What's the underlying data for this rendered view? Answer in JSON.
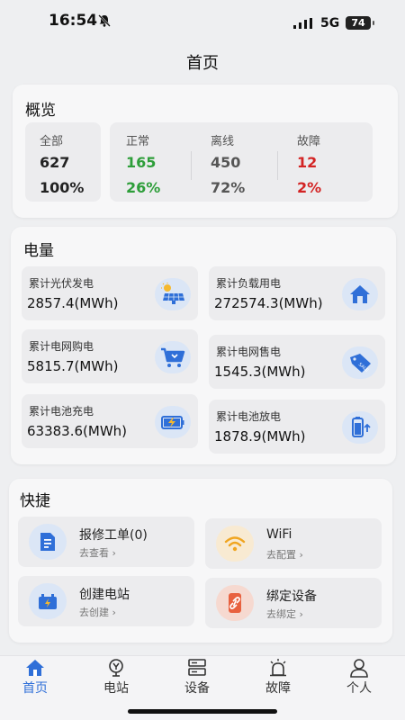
{
  "status_bar": {
    "time": "16:54",
    "network": "5G",
    "battery": "74"
  },
  "page": {
    "title": "首页"
  },
  "overview": {
    "title": "概览",
    "all": {
      "label": "全部",
      "count": "627",
      "percent": "100%"
    },
    "normal": {
      "label": "正常",
      "count": "165",
      "percent": "26%",
      "color": "#2e9e3a"
    },
    "offline": {
      "label": "离线",
      "count": "450",
      "percent": "72%",
      "color": "#555555"
    },
    "fault": {
      "label": "故障",
      "count": "12",
      "percent": "2%",
      "color": "#d32424"
    }
  },
  "energy": {
    "title": "电量",
    "items": [
      {
        "label": "累计光伏发电",
        "value": "2857.4(MWh)",
        "icon": "solar-panel-icon"
      },
      {
        "label": "累计负载用电",
        "value": "272574.3(MWh)",
        "icon": "home-icon"
      },
      {
        "label": "累计电网购电",
        "value": "5815.7(MWh)",
        "icon": "cart-icon"
      },
      {
        "label": "累计电网售电",
        "value": "1545.3(MWh)",
        "icon": "sale-tag-icon"
      },
      {
        "label": "累计电池充电",
        "value": "63383.6(MWh)",
        "icon": "battery-charge-icon"
      },
      {
        "label": "累计电池放电",
        "value": "1878.9(MWh)",
        "icon": "battery-discharge-icon"
      }
    ]
  },
  "quick": {
    "title": "快捷",
    "items": [
      {
        "label": "报修工单(0)",
        "sub": "去查看",
        "icon": "document-icon"
      },
      {
        "label": "WiFi",
        "sub": "去配置",
        "icon": "wifi-icon"
      },
      {
        "label": "创建电站",
        "sub": "去创建",
        "icon": "station-icon"
      },
      {
        "label": "绑定设备",
        "sub": "去绑定",
        "icon": "link-icon"
      }
    ]
  },
  "tabs": [
    {
      "label": "首页",
      "icon": "home-tab-icon",
      "active": true
    },
    {
      "label": "电站",
      "icon": "station-tab-icon",
      "active": false
    },
    {
      "label": "设备",
      "icon": "device-tab-icon",
      "active": false
    },
    {
      "label": "故障",
      "icon": "alarm-tab-icon",
      "active": false
    },
    {
      "label": "个人",
      "icon": "person-tab-icon",
      "active": false
    }
  ],
  "colors": {
    "accent": "#2f6fd8",
    "normal": "#2e9e3a",
    "fault": "#d32424"
  }
}
